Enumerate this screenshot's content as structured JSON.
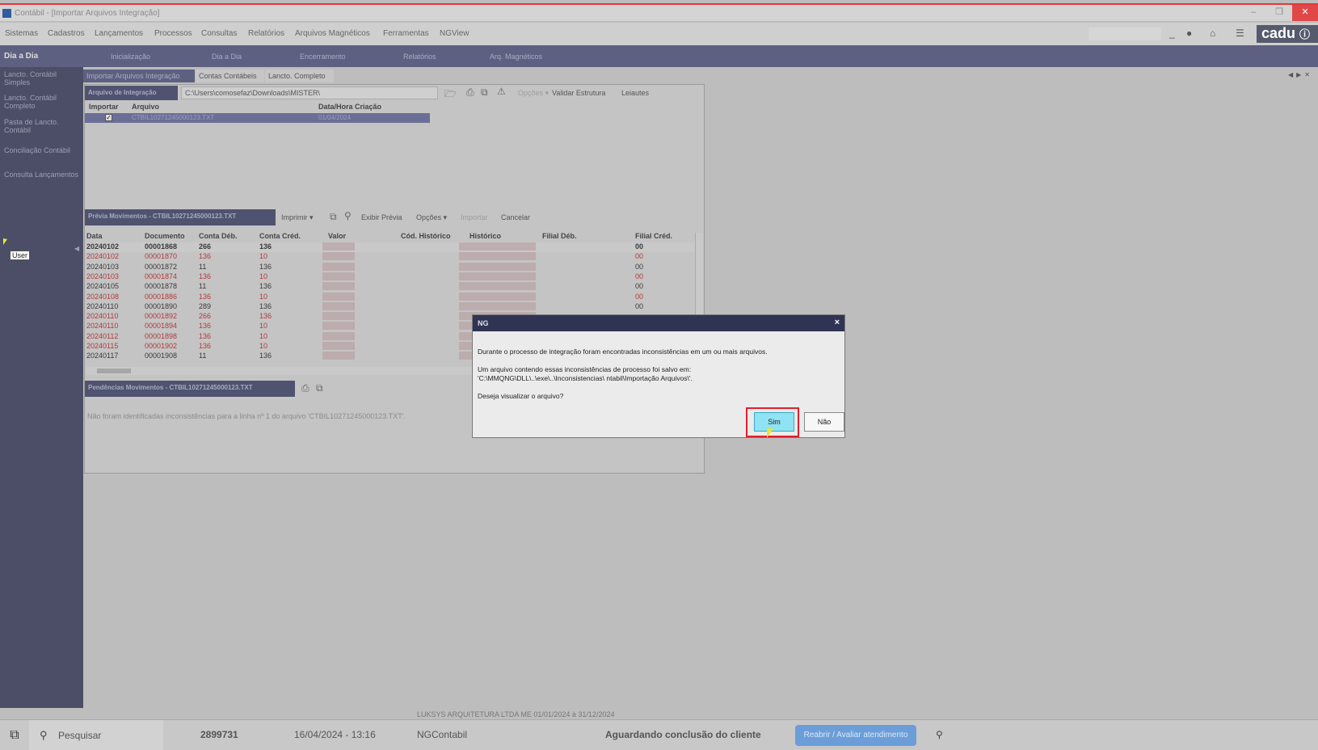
{
  "window": {
    "title": "Contábil - [Importar Arquivos Integração]"
  },
  "menu": [
    "Sistemas",
    "Cadastros",
    "Lançamentos",
    "Processos",
    "Consultas",
    "Relatórios",
    "Arquivos Magnéticos",
    "Ferramentas",
    "NGView"
  ],
  "brand": {
    "logo": "cadu"
  },
  "sidebar": {
    "header": "Dia a Dia",
    "items": [
      "Lancto. Contábil Simples",
      "Lancto. Contábil Completo",
      "Pasta de Lancto. Contábil",
      "Conciliação Contábil",
      "Consulta Lançamentos"
    ]
  },
  "topnav": [
    "Inicialização",
    "Dia a Dia",
    "Encerramento",
    "Relatórios",
    "Arq. Magnéticos"
  ],
  "tabs": [
    "Importar Arquivos Integração",
    "Contas Contábeis",
    "Lancto. Completo"
  ],
  "integration": {
    "label": "Arquivo de Integração",
    "path": "C:\\Users\\comosefaz\\Downloads\\MISTER\\",
    "opcoes": "Opções",
    "validar": "Validar Estrutura",
    "leiautes": "Leiautes",
    "columns": [
      "Importar",
      "Arquivo",
      "Data/Hora Criação"
    ],
    "file": {
      "name": "CTBIL10271245000123.TXT",
      "date": "01/04/2024",
      "checked": true
    }
  },
  "preview": {
    "label": "Prévia Movimentos - CTBIL10271245000123.TXT",
    "imprimir": "Imprimir",
    "exibir": "Exibir Prévia",
    "opcoes": "Opções",
    "importar": "Importar",
    "cancelar": "Cancelar",
    "columns": [
      "Data",
      "Documento",
      "Conta Déb.",
      "Conta Créd.",
      "Valor",
      "Cód. Histórico",
      "Histórico",
      "Filial Déb.",
      "Filial Créd."
    ],
    "rows": [
      {
        "data": "20240102",
        "doc": "00001868",
        "deb": "266",
        "cred": "136",
        "filial": "00",
        "red": false
      },
      {
        "data": "20240102",
        "doc": "00001870",
        "deb": "136",
        "cred": "10",
        "filial": "00",
        "red": true
      },
      {
        "data": "20240103",
        "doc": "00001872",
        "deb": "11",
        "cred": "136",
        "filial": "00",
        "red": false
      },
      {
        "data": "20240103",
        "doc": "00001874",
        "deb": "136",
        "cred": "10",
        "filial": "00",
        "red": true
      },
      {
        "data": "20240105",
        "doc": "00001878",
        "deb": "11",
        "cred": "136",
        "filial": "00",
        "red": false
      },
      {
        "data": "20240108",
        "doc": "00001886",
        "deb": "136",
        "cred": "10",
        "filial": "00",
        "red": true
      },
      {
        "data": "20240110",
        "doc": "00001890",
        "deb": "289",
        "cred": "136",
        "filial": "00",
        "red": false
      },
      {
        "data": "20240110",
        "doc": "00001892",
        "deb": "266",
        "cred": "136",
        "filial": "",
        "red": true
      },
      {
        "data": "20240110",
        "doc": "00001894",
        "deb": "136",
        "cred": "10",
        "filial": "",
        "red": true
      },
      {
        "data": "20240112",
        "doc": "00001898",
        "deb": "136",
        "cred": "10",
        "filial": "",
        "red": true
      },
      {
        "data": "20240115",
        "doc": "00001902",
        "deb": "136",
        "cred": "10",
        "filial": "",
        "red": true
      },
      {
        "data": "20240117",
        "doc": "00001908",
        "deb": "11",
        "cred": "136",
        "filial": "",
        "red": false
      }
    ]
  },
  "pending": {
    "label": "Pendências Movimentos - CTBIL10271245000123.TXT",
    "message": "Não foram identificadas inconsistências para a linha nº 1 do arquivo 'CTBIL10271245000123.TXT'."
  },
  "cursor_label": "User",
  "dialog": {
    "title": "NG",
    "line1": "Durante o processo de integração foram encontradas inconsistências em um ou mais arquivos.",
    "line2": "Um arquivo contendo essas inconsistências de processo foi salvo em:",
    "line3": "'C:\\MMQNG\\DLL\\..\\exe\\..\\Inconsistencias\\         ntabil\\Importação Arquivos\\'.",
    "line4": "Deseja visualizar o arquivo?",
    "yes": "Sim",
    "no": "Não"
  },
  "status": {
    "company": "LUKSYS ARQUITETURA LTDA ME  01/01/2024 à 31/12/2024"
  },
  "taskbar": {
    "search": "Pesquisar",
    "ticket": "2899731",
    "datetime": "16/04/2024 - 13:16",
    "app": "NGContabil",
    "state": "Aguardando conclusão do cliente",
    "button": "Reabrir / Avaliar atendimento"
  }
}
